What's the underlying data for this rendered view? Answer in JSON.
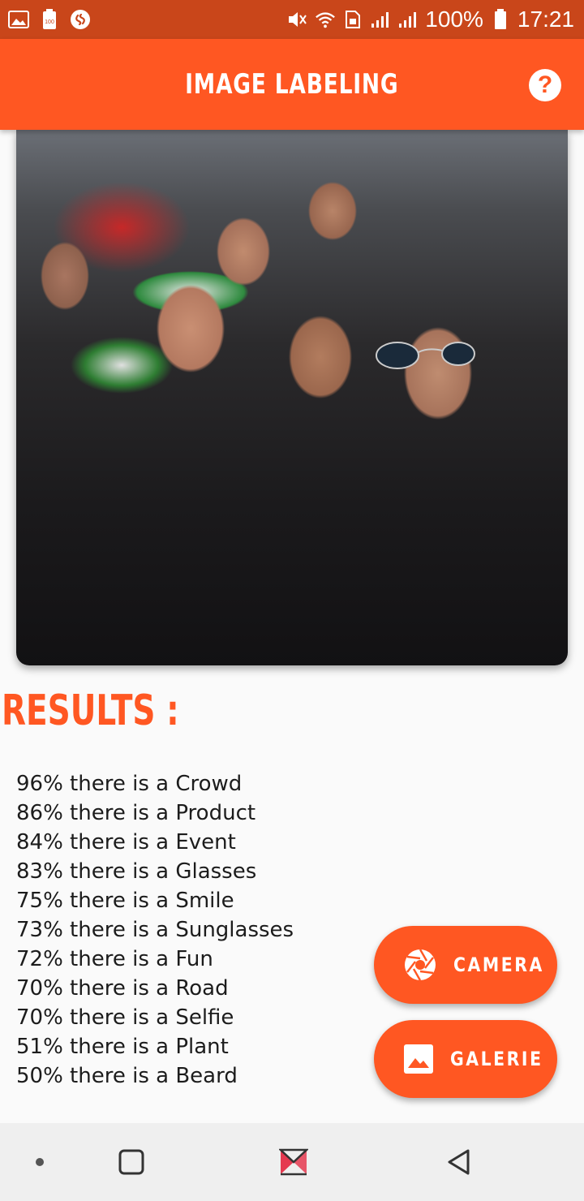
{
  "status_bar": {
    "battery_percent": "100%",
    "time": "17:21",
    "battery_badge": "100",
    "icons": [
      "gallery-icon",
      "battery-saver-icon",
      "shazam-icon",
      "mute-icon",
      "wifi-icon",
      "sim-icon",
      "signal-icon",
      "signal-icon",
      "battery-icon"
    ]
  },
  "app_bar": {
    "title": "IMAGE LABELING",
    "help_glyph": "?"
  },
  "results": {
    "heading": "RESULTS :",
    "items": [
      "96% there is a Crowd",
      "86% there is a Product",
      "84% there is a Event",
      "83% there is a Glasses",
      "75% there is a Smile",
      "73% there is a Sunglasses",
      "72% there is a Fun",
      "70% there is a Road",
      "70% there is a Selfie",
      "51% there is a Plant",
      "50% there is a Beard"
    ]
  },
  "buttons": {
    "camera_label": "CAMERA",
    "gallery_label": "GALERIE"
  },
  "colors": {
    "accent": "#ff5722",
    "status_bar": "#c9461a",
    "background": "#fafafa"
  }
}
